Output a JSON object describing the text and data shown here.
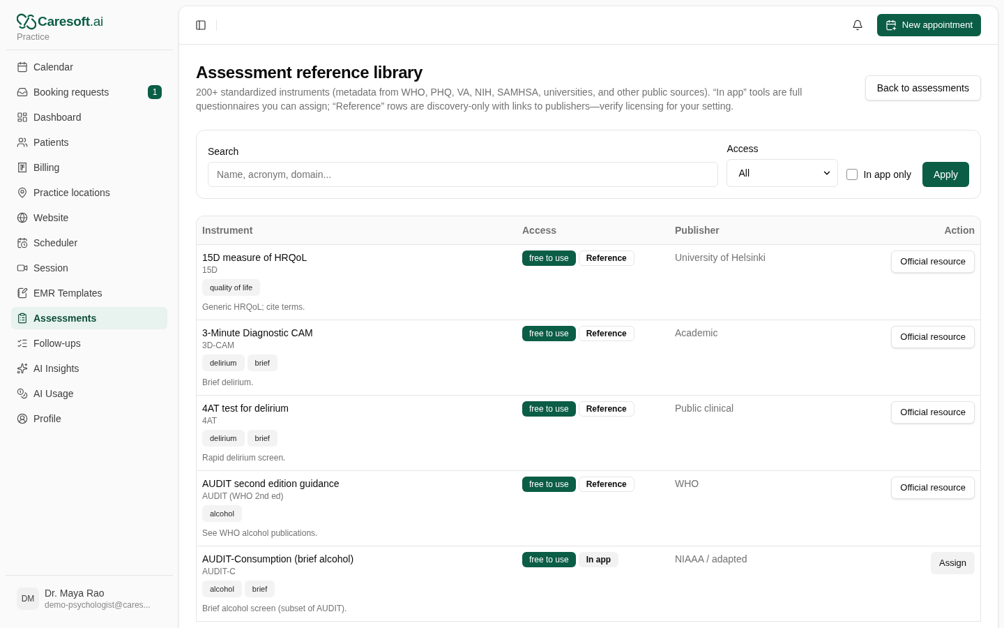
{
  "sidebar": {
    "logo": "**Caresoft**.ai",
    "subtitle": "Practice",
    "items": [
      {
        "label": "Calendar",
        "selected": false
      },
      {
        "label": "Booking requests",
        "selected": false,
        "badge": "1"
      },
      {
        "label": "Dashboard",
        "selected": false
      },
      {
        "label": "Patients",
        "selected": false
      },
      {
        "label": "Billing",
        "selected": false
      },
      {
        "label": "Practice locations",
        "selected": false
      },
      {
        "label": "Website",
        "selected": false
      },
      {
        "label": "Scheduler",
        "selected": false
      },
      {
        "label": "Session",
        "selected": false
      },
      {
        "label": "EMR Templates",
        "selected": false
      },
      {
        "label": "Assessments",
        "selected": true
      },
      {
        "label": "Follow-ups",
        "selected": false
      },
      {
        "label": "AI Insights",
        "selected": false
      },
      {
        "label": "AI Usage",
        "selected": false
      },
      {
        "label": "Profile",
        "selected": false
      }
    ],
    "user": {
      "initials": "DM",
      "name": "Dr. Maya Rao",
      "email": "demo-psychologist@cares..."
    }
  },
  "header": {
    "new_appointment": "New appointment"
  },
  "page": {
    "title": "Assessment reference library",
    "description": "200+ standardized instruments (metadata from WHO, PHQ, VA, NIH, SAMHSA, universities, and other public sources). “In app” tools are full questionnaires you can assign; “Reference” rows are discovery-only with links to publishers—verify licensing for your setting.",
    "back_button": "Back to assessments"
  },
  "filters": {
    "search_label": "Search",
    "search_placeholder": "Name, acronym, domain...",
    "access_label": "Access",
    "access_value": "All",
    "in_app_only": {
      "label": "In app only",
      "checked": false
    },
    "apply": "Apply"
  },
  "table": {
    "columns": [
      "Instrument",
      "Access",
      "Publisher",
      "Action"
    ],
    "rows": [
      {
        "name": "15D measure of HRQoL",
        "acronym": "15D",
        "tags": [
          "quality of life"
        ],
        "note": "Generic HRQoL; cite terms.",
        "license": "free to use",
        "access": {
          "label": "Reference",
          "kind": "reference"
        },
        "publisher": "University of Helsinki",
        "action": {
          "label": "Official resource",
          "kind": "link"
        }
      },
      {
        "name": "3-Minute Diagnostic CAM",
        "acronym": "3D-CAM",
        "tags": [
          "delirium",
          "brief"
        ],
        "note": "Brief delirium.",
        "license": "free to use",
        "access": {
          "label": "Reference",
          "kind": "reference"
        },
        "publisher": "Academic",
        "action": {
          "label": "Official resource",
          "kind": "link"
        }
      },
      {
        "name": "4AT test for delirium",
        "acronym": "4AT",
        "tags": [
          "delirium",
          "brief"
        ],
        "note": "Rapid delirium screen.",
        "license": "free to use",
        "access": {
          "label": "Reference",
          "kind": "reference"
        },
        "publisher": "Public clinical",
        "action": {
          "label": "Official resource",
          "kind": "link"
        }
      },
      {
        "name": "AUDIT second edition guidance",
        "acronym": "AUDIT (WHO 2nd ed)",
        "tags": [
          "alcohol"
        ],
        "note": "See WHO alcohol publications.",
        "license": "free to use",
        "access": {
          "label": "Reference",
          "kind": "reference"
        },
        "publisher": "WHO",
        "action": {
          "label": "Official resource",
          "kind": "link"
        }
      },
      {
        "name": "AUDIT-Consumption (brief alcohol)",
        "acronym": "AUDIT-C",
        "tags": [
          "alcohol",
          "brief"
        ],
        "note": "Brief alcohol screen (subset of AUDIT).",
        "license": "free to use",
        "access": {
          "label": "In app",
          "kind": "in_app"
        },
        "publisher": "NIAAA / adapted",
        "action": {
          "label": "Assign",
          "kind": "assign"
        }
      }
    ]
  }
}
